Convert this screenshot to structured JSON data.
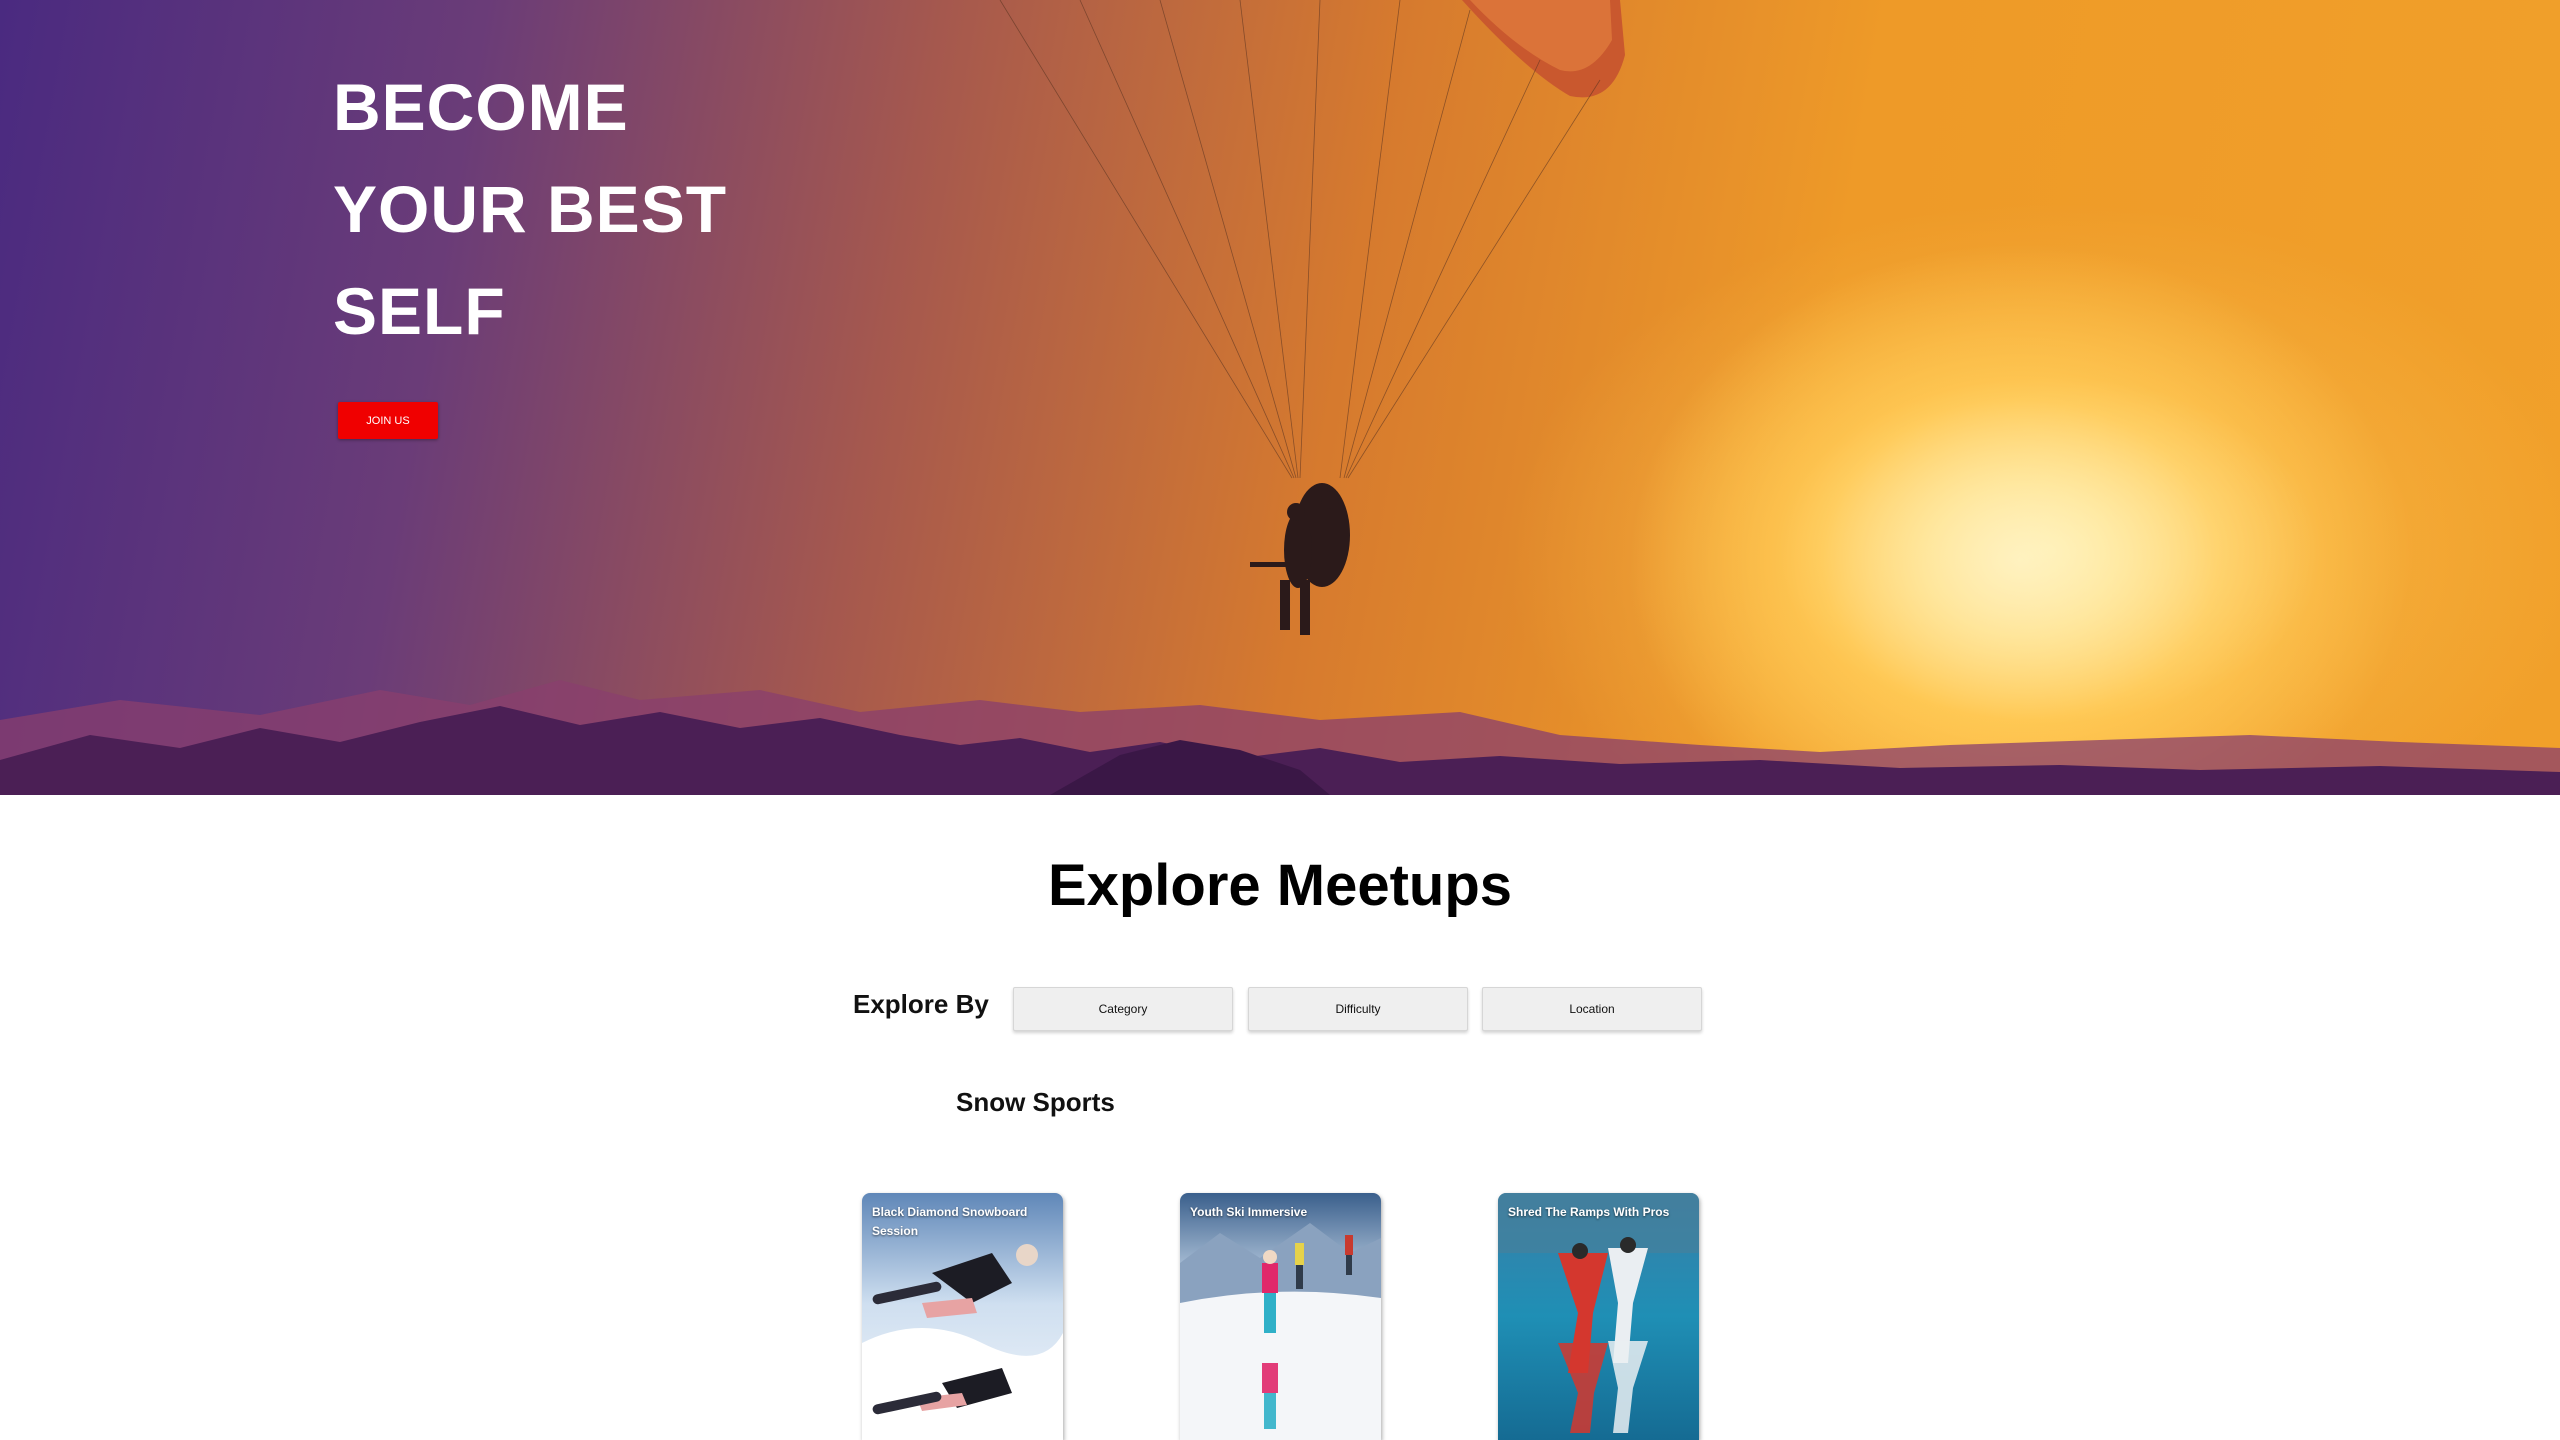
{
  "hero": {
    "title_lines": [
      "BECOME",
      "YOUR BEST",
      "SELF"
    ],
    "cta_label": "JOIN US"
  },
  "explore": {
    "title": "Explore Meetups",
    "explore_by_label": "Explore By",
    "filters": [
      "Category",
      "Difficulty",
      "Location"
    ]
  },
  "category": {
    "title": "Snow Sports",
    "cards": [
      {
        "title": "Black Diamond Snowboard Session",
        "image": "snowboarder-photo"
      },
      {
        "title": "Youth Ski Immersive",
        "image": "skiers-photo"
      },
      {
        "title": "Shred The Ramps With Pros",
        "image": "wingsuit-photo"
      }
    ]
  },
  "colors": {
    "accent": "#f00000",
    "hero_gradient_start": "#4a2a80",
    "hero_gradient_end": "#f1a02a"
  }
}
